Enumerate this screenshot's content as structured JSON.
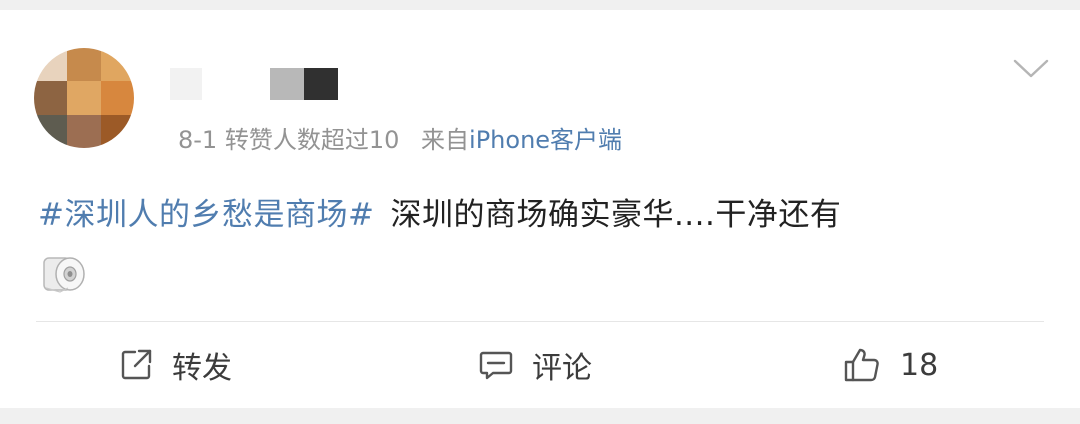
{
  "post": {
    "meta": {
      "date": "8-1",
      "repost_note": "转赞人数超过10",
      "source_prefix": "来自",
      "device": "iPhone客户端"
    },
    "topic": "#深圳人的乡愁是商场#",
    "text": "深圳的商场确实豪华....干净还有",
    "inline_emoji_icon": "toilet-paper-icon"
  },
  "actions": {
    "repost_label": "转发",
    "comment_label": "评论",
    "like_count": "18"
  },
  "colors": {
    "link_blue": "#507daf",
    "meta_gray": "#939393",
    "text": "#222222",
    "background": "#f0f0f0",
    "card": "#ffffff"
  },
  "avatar_pixels": [
    "#e8d3bd",
    "#c68a4c",
    "#e0a660",
    "#8d6442",
    "#e0a763",
    "#d7873e",
    "#5e5c50",
    "#9c6e52",
    "#9c5a27"
  ]
}
